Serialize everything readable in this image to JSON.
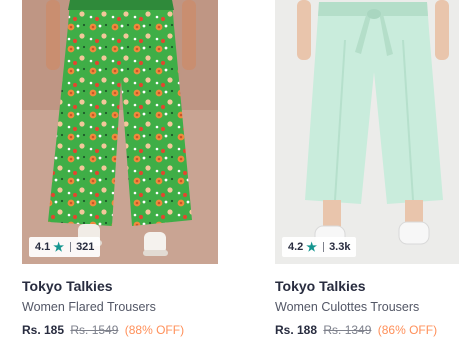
{
  "products": [
    {
      "rating": "4.1",
      "rating_count": "321",
      "brand": "Tokyo Talkies",
      "name": "Women Flared Trousers",
      "price": "Rs. 185",
      "mrp": "Rs. 1549",
      "discount": "(88% OFF)",
      "image_colors": {
        "backdrop": "#c9a493",
        "fabric": "#3fae47"
      }
    },
    {
      "rating": "4.2",
      "rating_count": "3.3k",
      "brand": "Tokyo Talkies",
      "name": "Women Culottes Trousers",
      "price": "Rs. 188",
      "mrp": "Rs. 1349",
      "discount": "(86% OFF)",
      "image_colors": {
        "backdrop": "#ececea",
        "fabric": "#c9ecdc"
      }
    }
  ],
  "colors": {
    "star": "#14958f",
    "discount": "#ff905a",
    "text": "#282c3f",
    "muted": "#7e818c"
  },
  "icons": {
    "rating": "star-icon"
  }
}
